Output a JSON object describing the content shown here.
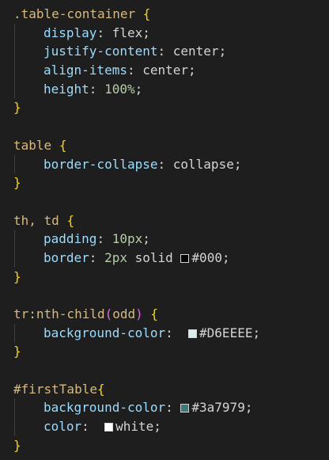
{
  "editor": {
    "lines": [
      {
        "kind": "selector",
        "selector": ".table-container",
        "brace": "{"
      },
      {
        "kind": "decl",
        "prop": "display",
        "value": "flex"
      },
      {
        "kind": "decl",
        "prop": "justify-content",
        "value": "center"
      },
      {
        "kind": "decl",
        "prop": "align-items",
        "value": "center"
      },
      {
        "kind": "decl-num",
        "prop": "height",
        "value": "100%"
      },
      {
        "kind": "close",
        "brace": "}"
      },
      {
        "kind": "blank"
      },
      {
        "kind": "selector",
        "selector": "table",
        "brace": "{"
      },
      {
        "kind": "decl",
        "prop": "border-collapse",
        "value": "collapse"
      },
      {
        "kind": "close",
        "brace": "}"
      },
      {
        "kind": "blank"
      },
      {
        "kind": "selector",
        "selector": "th, td",
        "brace": "{"
      },
      {
        "kind": "decl-num",
        "prop": "padding",
        "value": "10px"
      },
      {
        "kind": "decl-border",
        "prop": "border",
        "num": "2px",
        "style": "solid",
        "color": "#000",
        "swatch": "#000000"
      },
      {
        "kind": "close",
        "brace": "}"
      },
      {
        "kind": "blank"
      },
      {
        "kind": "selector-paren",
        "selector": "tr:nth-child",
        "arg": "odd",
        "brace": "{"
      },
      {
        "kind": "decl-color",
        "prop": "background-color",
        "value": "#D6EEEE",
        "swatch": "#D6EEEE",
        "gap": " "
      },
      {
        "kind": "close",
        "brace": "}"
      },
      {
        "kind": "blank"
      },
      {
        "kind": "selector",
        "selector": "#firstTable",
        "brace": "{",
        "nospace": true
      },
      {
        "kind": "decl-color",
        "prop": "background-color",
        "value": "#3a7979",
        "swatch": "#3a7979",
        "gap": ""
      },
      {
        "kind": "decl-color",
        "prop": "color",
        "value": "white",
        "swatch": "#ffffff",
        "gap": " "
      },
      {
        "kind": "close",
        "brace": "}"
      }
    ]
  }
}
